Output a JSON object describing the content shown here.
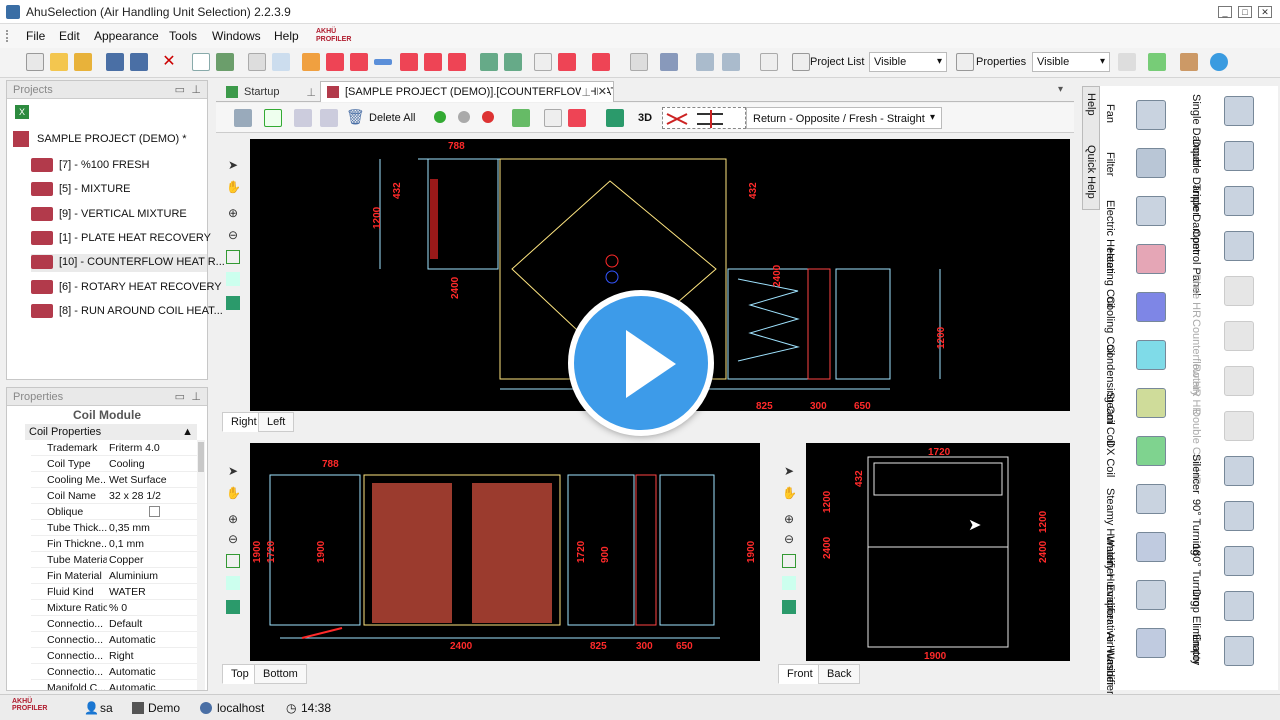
{
  "app": {
    "title": "AhuSelection (Air Handling Unit Selection) 2.2.3.9",
    "brand": "AKHÜ PROFILER"
  },
  "window_buttons": [
    "_",
    "□",
    "✕"
  ],
  "menu": [
    "File",
    "Edit",
    "Appearance",
    "Tools",
    "Windows",
    "Help"
  ],
  "toolbar": {
    "project_list_label": "Project List",
    "project_list_value": "Visible",
    "properties_label": "Properties",
    "properties_value": "Visible"
  },
  "projects_panel": {
    "title": "Projects",
    "root": "SAMPLE PROJECT (DEMO) *",
    "items": [
      "[7] - %100 FRESH",
      "[5] - MIXTURE",
      "[9] - VERTICAL MIXTURE",
      "[1] - PLATE HEAT RECOVERY",
      "[10] - COUNTERFLOW HEAT R...",
      "[6] - ROTARY HEAT RECOVERY",
      "[8] - RUN AROUND COIL HEAT..."
    ]
  },
  "properties_panel": {
    "title": "Properties",
    "module": "Coil Module",
    "section": "Coil Properties",
    "rows": [
      {
        "k": "Trademark",
        "v": "Friterm 4.0"
      },
      {
        "k": "Coil Type",
        "v": "Cooling"
      },
      {
        "k": "Cooling Me...",
        "v": "Wet Surface"
      },
      {
        "k": "Coil Name",
        "v": "32 x 28 1/2"
      },
      {
        "k": "Oblique",
        "v": ""
      },
      {
        "k": "Tube Thick...",
        "v": "0,35 mm"
      },
      {
        "k": "Fin Thickne...",
        "v": "0,1 mm"
      },
      {
        "k": "Tube Material",
        "v": "Copper"
      },
      {
        "k": "Fin Material",
        "v": "Aluminium"
      },
      {
        "k": "Fluid Kind",
        "v": "WATER"
      },
      {
        "k": "Mixture Ratio",
        "v": "% 0"
      },
      {
        "k": "Connectio...",
        "v": "Default"
      },
      {
        "k": "Connectio...",
        "v": "Automatic"
      },
      {
        "k": "Connectio...",
        "v": "Right"
      },
      {
        "k": "Connectio...",
        "v": "Automatic"
      },
      {
        "k": "Manifold C...",
        "v": "Automatic"
      }
    ]
  },
  "doc_tabs": {
    "startup": "Startup",
    "active": "[SAMPLE PROJECT (DEMO)].[COUNTERFLOW HEAT"
  },
  "doc_toolbar": {
    "delete_all": "Delete All",
    "view_3d": "3D",
    "flow_mode": "Return - Opposite / Fresh - Straight"
  },
  "views": {
    "top_tabs": [
      "Right",
      "Left"
    ],
    "bottom_left_tabs": [
      "Top",
      "Bottom"
    ],
    "bottom_right_tabs": [
      "Front",
      "Back"
    ]
  },
  "dims": {
    "right_view": [
      "788",
      "432",
      "1200",
      "432",
      "2400",
      "2400",
      "1200",
      "825",
      "300",
      "650"
    ],
    "top_view": [
      "788",
      "1900",
      "1720",
      "1900",
      "1720",
      "900",
      "1900",
      "2400",
      "825",
      "300",
      "650"
    ],
    "front_view": [
      "1720",
      "432",
      "1200",
      "2400",
      "1200",
      "2400",
      "1900"
    ]
  },
  "side_tabs": [
    "Help",
    "Quick Help"
  ],
  "components_col1": [
    "Fan",
    "Filter",
    "Electric Heater",
    "Heating Coil",
    "Cooling Coil",
    "Condensing Coil",
    "Steam Coil",
    "DX Coil",
    "Steamy Humidifier",
    "Watery Humidifier",
    "Evaporative Humidifier",
    "Air Washer"
  ],
  "components_col2": [
    "Single Damper",
    "Double Damper",
    "Triple Damper",
    "Control Panel",
    "Plate HR",
    "Counterflow HR",
    "Rotary HR",
    "Double Coil HR",
    "Silencer",
    "90° Turning",
    "180° Turning",
    "Drop Eliminator",
    "Empty"
  ],
  "components_col2_disabled": [
    4,
    5,
    6,
    7
  ],
  "status": {
    "user": "sa",
    "db": "Demo",
    "server": "localhost",
    "time": "14:38"
  },
  "colors": {
    "cad_bg": "#000000",
    "dim_red": "#ff2a2a",
    "outline_yellow": "#ffe680",
    "line_cyan": "#9fe3ff",
    "play_blue": "#3d9be9"
  }
}
